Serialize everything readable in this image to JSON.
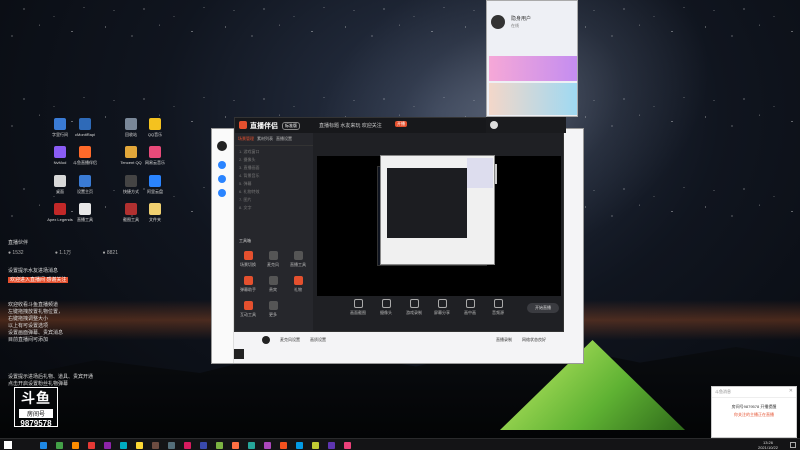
{
  "desktop": {
    "icons": [
      {
        "label": "字里行间",
        "color": "#3a7bd5"
      },
      {
        "label": "cMonitRapi",
        "color": "#2e6ab8"
      },
      {
        "label": "回收站",
        "color": "#7a8899"
      },
      {
        "label": "QQ音乐",
        "color": "#f4c21f"
      },
      {
        "label": "NvMod",
        "color": "#8a5cf5"
      },
      {
        "label": "斗鱼直播伴侣",
        "color": "#ff6a2a"
      },
      {
        "label": "Tencent QQ",
        "color": "#e2a73a"
      },
      {
        "label": "网易云音乐",
        "color": "#e84a7a"
      },
      {
        "label": "桌面",
        "color": "#d8d8d8"
      },
      {
        "label": "设置主页",
        "color": "#3a7bd5"
      },
      {
        "label": "快捷方式",
        "color": "#444"
      },
      {
        "label": "阿里云盘",
        "color": "#2a84ff"
      },
      {
        "label": "Apex Legends",
        "color": "#c22828"
      },
      {
        "label": "直播工具",
        "color": "#e8e8e8"
      },
      {
        "label": "截图工具",
        "color": "#b03030"
      },
      {
        "label": "文件夹",
        "color": "#f0d070"
      }
    ]
  },
  "stream_overlay": {
    "live_label": "直播伙伴",
    "stats": [
      "● 1532",
      "● 1.1万",
      "● 8821"
    ],
    "line1": "设置提示水友进场消息",
    "line2_badge": "欢迎进入直播间 感谢关注",
    "notice_lines": [
      "欢迎收看斗鱼直播频道",
      "左键拖拽放置礼物位置，",
      "右键拖拽调整大小",
      "以上有可设置选项",
      "设置画面弹幕、贵宾消息",
      "目前直播间可添加"
    ],
    "footer_lines": [
      "设置提示进场后礼物、道具、贵宾开通",
      "点击开启设置粉丝礼物弹幕"
    ],
    "logo_main": "斗鱼",
    "logo_sub": "房间号",
    "room_id": "9879578"
  },
  "obs": {
    "title": "直播伴侣",
    "badge": "标准版",
    "tabs": [
      "场景管理",
      "素材列表",
      "直播设置"
    ],
    "scene_items": [
      "1. 游戏窗口",
      "2. 摄像头",
      "3. 直播画面",
      "4. 背景音乐",
      "5. 弹幕",
      "6. 礼物特效",
      "7. 图片",
      "8. 文字"
    ],
    "sidebar_section": "工具箱",
    "sidebar_tools": [
      "场景切换",
      "麦克风",
      "直播工具",
      "弹幕助手",
      "贵宾",
      "礼物",
      "互动工具",
      "更多"
    ],
    "stream_info": "直播标题 水友来玩 欢迎关注",
    "stream_tag": "开播",
    "toolbar_items": [
      "画面截图",
      "摄像头",
      "游戏录制",
      "屏幕分享",
      "画中画",
      "音频源"
    ],
    "end_button": "开始直播",
    "bottom_items": [
      "麦克风设置",
      "画质设置",
      "直播录制",
      "网络状态良好"
    ]
  },
  "chat": {
    "name": "隐身用户",
    "status": "在线"
  },
  "notification": {
    "header": "斗鱼消息",
    "line1": "房间号9879578 开播提醒",
    "line2": "你关注的主播正在直播"
  },
  "taskbar": {
    "time": "13:26",
    "date": "2021/10/22",
    "colors": [
      "#1e88e5",
      "#43a047",
      "#fb8c00",
      "#e53935",
      "#8e24aa",
      "#00acc1",
      "#fdd835",
      "#6d4c41",
      "#546e7a",
      "#d81b60",
      "#3949ab",
      "#7cb342",
      "#ff7043",
      "#26a69a",
      "#ab47bc",
      "#f4511e",
      "#039be5",
      "#c0ca33",
      "#5e35b1",
      "#ec407a"
    ]
  }
}
